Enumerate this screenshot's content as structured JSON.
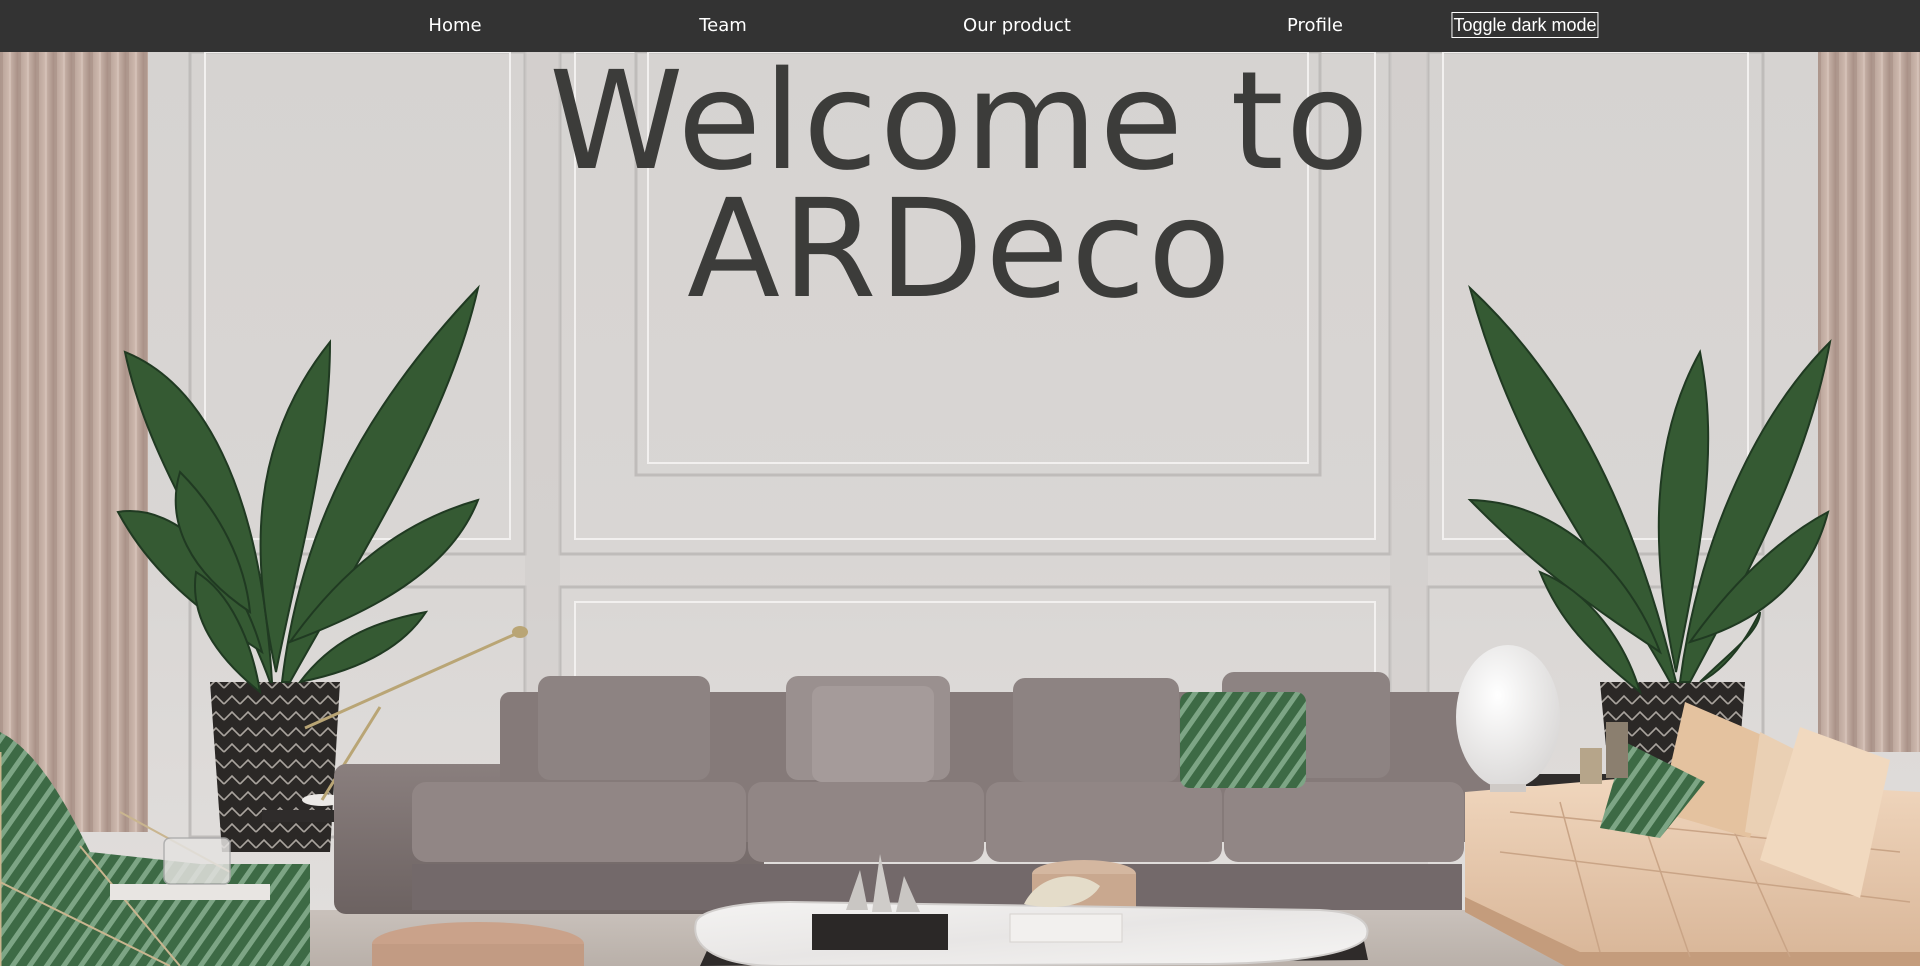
{
  "nav": {
    "items": [
      {
        "label": "Home"
      },
      {
        "label": "Team"
      },
      {
        "label": "Our product"
      },
      {
        "label": "Profile"
      }
    ],
    "toggle_label": "Toggle dark mode"
  },
  "hero": {
    "title_line1": "Welcome to",
    "title_line2": "ARDeco",
    "image_subject": "living-room-interior"
  },
  "colors": {
    "nav_bg": "#333333",
    "nav_text": "#ffffff",
    "title_text": "#3c3c3a",
    "wall": "#dcd9d7",
    "sofa": "#7b7170",
    "leather_sofa": "#e7c9ad",
    "plant_green": "#355a33"
  }
}
